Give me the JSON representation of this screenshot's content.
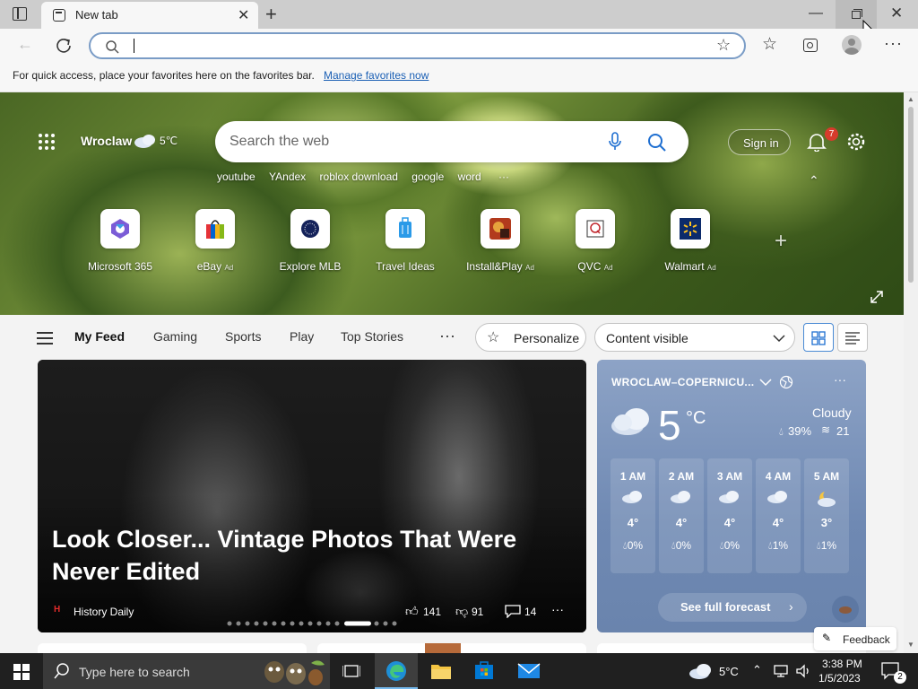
{
  "browser": {
    "tab_title": "New tab",
    "address_value": "",
    "favorites_hint": "For quick access, place your favorites here on the favorites bar.",
    "manage_favorites_link": "Manage favorites now"
  },
  "hero": {
    "location": "Wroclaw",
    "temperature": "5℃",
    "search_placeholder": "Search the web",
    "sign_in": "Sign in",
    "notification_count": "7",
    "suggestions": [
      "youtube",
      "YAndex",
      "roblox download",
      "google",
      "word"
    ],
    "quick_links": [
      {
        "label": "Microsoft 365",
        "ad": ""
      },
      {
        "label": "eBay",
        "ad": "Ad"
      },
      {
        "label": "Explore MLB",
        "ad": ""
      },
      {
        "label": "Travel Ideas",
        "ad": ""
      },
      {
        "label": "Install&Play",
        "ad": "Ad"
      },
      {
        "label": "QVC",
        "ad": "Ad"
      },
      {
        "label": "Walmart",
        "ad": "Ad"
      }
    ]
  },
  "feed_nav": {
    "tabs": [
      "My Feed",
      "Gaming",
      "Sports",
      "Play",
      "Top Stories"
    ],
    "personalize": "Personalize",
    "content_visibility": "Content visible"
  },
  "main_story": {
    "headline": "Look Closer... Vintage Photos That Were Never Edited",
    "source": "History Daily",
    "likes": "141",
    "dislikes": "91",
    "comments": "14"
  },
  "weather": {
    "location": "WROCLAW–COPERNICU...",
    "temp": "5",
    "unit": "°C",
    "condition": "Cloudy",
    "humidity": "39%",
    "wind": "21",
    "hours": [
      {
        "time": "1 AM",
        "temp": "4°",
        "precip": "0%"
      },
      {
        "time": "2 AM",
        "temp": "4°",
        "precip": "0%"
      },
      {
        "time": "3 AM",
        "temp": "4°",
        "precip": "0%"
      },
      {
        "time": "4 AM",
        "temp": "4°",
        "precip": "1%"
      },
      {
        "time": "5 AM",
        "temp": "3°",
        "precip": "1%"
      }
    ],
    "forecast_button": "See full forecast",
    "feedback": "Feedback"
  },
  "taskbar": {
    "search_placeholder": "Type here to search",
    "weather": "5°C",
    "time": "3:38 PM",
    "date": "1/5/2023",
    "notification_count": "2"
  }
}
